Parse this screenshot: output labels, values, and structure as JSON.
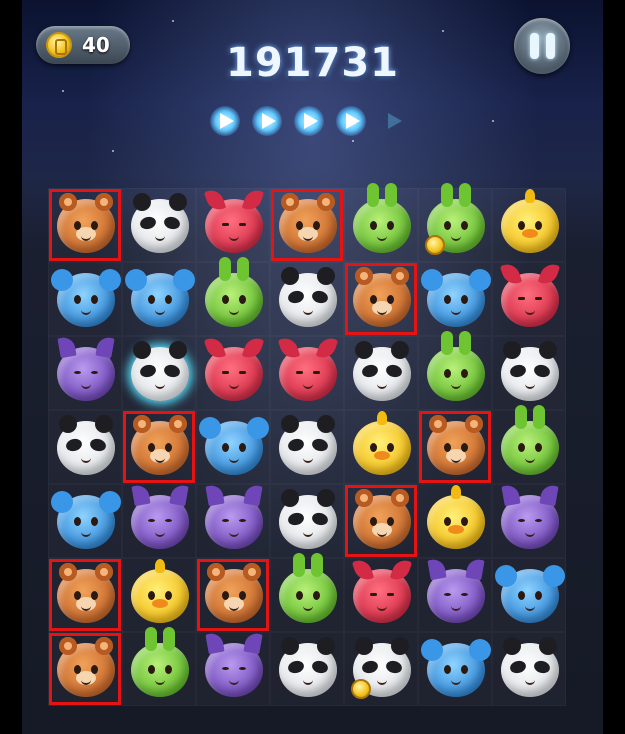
{
  "hud": {
    "coins": "40",
    "score": "191731",
    "progress_filled": 4,
    "progress_total": 5
  },
  "board": {
    "rows": [
      [
        "bear",
        "panda",
        "fox",
        "bear",
        "rabbit",
        "rabbit",
        "chick"
      ],
      [
        "mouse",
        "mouse",
        "rabbit",
        "panda",
        "bear",
        "mouse",
        "fox"
      ],
      [
        "cat",
        "panda",
        "fox",
        "fox",
        "panda",
        "rabbit",
        "panda"
      ],
      [
        "panda",
        "bear",
        "mouse",
        "panda",
        "chick",
        "bear",
        "rabbit"
      ],
      [
        "mouse",
        "cat",
        "cat",
        "panda",
        "bear",
        "chick",
        "cat"
      ],
      [
        "bear",
        "chick",
        "bear",
        "rabbit",
        "fox",
        "cat",
        "mouse"
      ],
      [
        "bear",
        "rabbit",
        "cat",
        "panda",
        "panda",
        "mouse",
        "panda"
      ]
    ],
    "highlighted": [
      [
        0,
        0
      ],
      [
        0,
        3
      ],
      [
        1,
        4
      ],
      [
        3,
        1
      ],
      [
        3,
        5
      ],
      [
        4,
        4
      ],
      [
        5,
        0
      ],
      [
        5,
        2
      ],
      [
        6,
        0
      ]
    ],
    "special": [
      [
        2,
        1
      ]
    ],
    "coin_tiles": [
      [
        0,
        5
      ],
      [
        6,
        4
      ]
    ],
    "highlight_color": "#e51414"
  }
}
